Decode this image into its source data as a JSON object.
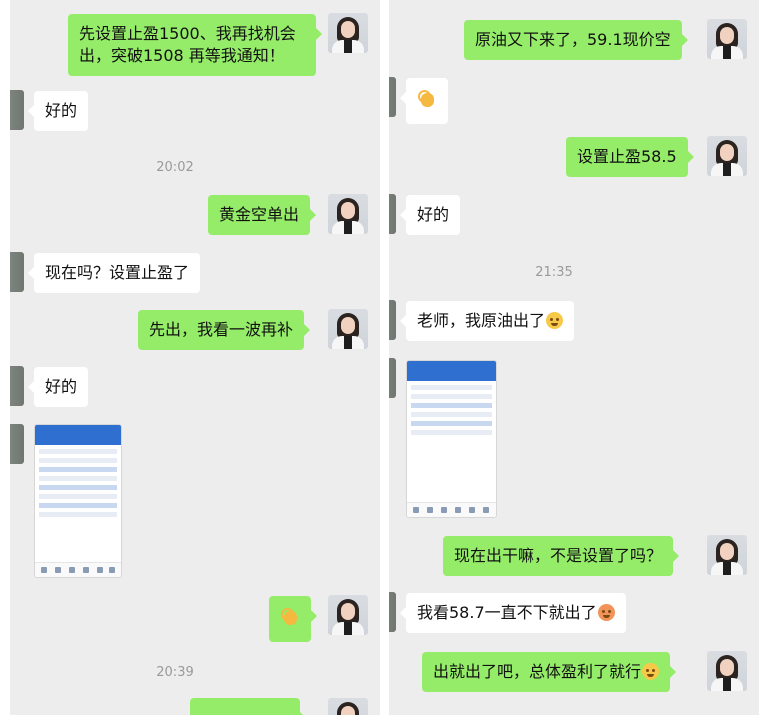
{
  "left_panel": {
    "messages": [
      {
        "side": "right",
        "text": "先设置止盈1500、我再找机会出，突破1508 再等我通知！"
      },
      {
        "side": "left",
        "text": "好的"
      },
      {
        "time": "20:02"
      },
      {
        "side": "right",
        "text": "黄金空单出"
      },
      {
        "side": "left",
        "text": "现在吗？设置止盈了"
      },
      {
        "side": "right",
        "text": "先出，我看一波再补"
      },
      {
        "side": "left",
        "text": "好的"
      },
      {
        "side": "left",
        "type": "screenshot"
      },
      {
        "side": "right",
        "type": "emoji",
        "emoji": "ok-hand"
      },
      {
        "time": "20:39"
      }
    ]
  },
  "right_panel": {
    "messages": [
      {
        "side": "right",
        "text": "原油又下来了，59.1现价空"
      },
      {
        "side": "left",
        "type": "emoji",
        "emoji": "ok-hand"
      },
      {
        "side": "right",
        "text": "设置止盈58.5"
      },
      {
        "side": "left",
        "text": "好的"
      },
      {
        "time": "21:35"
      },
      {
        "side": "left",
        "text": "老师，我原油出了",
        "emoji": "flushed-face"
      },
      {
        "side": "left",
        "type": "screenshot"
      },
      {
        "side": "right",
        "text": "现在出干嘛，不是设置了吗？"
      },
      {
        "side": "left",
        "text": "我看58.7一直不下就出了",
        "emoji": "pouting-face"
      },
      {
        "side": "right",
        "text": "出就出了吧，总体盈利了就行",
        "emoji": "laughing-face"
      }
    ]
  },
  "colors": {
    "chat_bg": "#ededed",
    "bubble_self": "#95ec69",
    "bubble_other": "#ffffff",
    "timestamp": "#9a9a9a"
  }
}
